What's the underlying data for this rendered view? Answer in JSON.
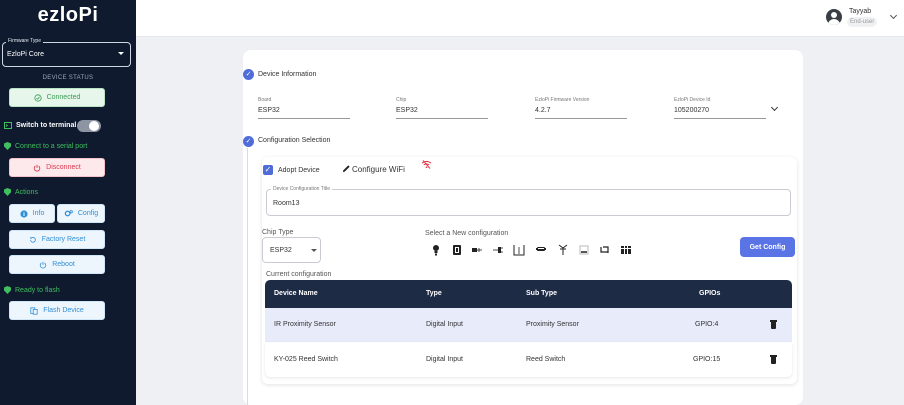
{
  "sidebar": {
    "logo": "ezloPi",
    "firmware_label": "Firmware Type",
    "firmware_value": "EzloPi Core",
    "device_status_label": "DEVICE STATUS",
    "connected_label": "Connected",
    "switch_terminal_label": "Switch to terminal",
    "connect_serial_label": "Connect to a serial port",
    "disconnect_label": "Disconnect",
    "actions_label": "Actions",
    "info_label": "Info",
    "config_label": "Config",
    "factory_reset_label": "Factory Reset",
    "reboot_label": "Reboot",
    "ready_flash_label": "Ready to flash",
    "flash_device_label": "Flash Device"
  },
  "header": {
    "user_name": "Tayyab",
    "user_role": "End-user"
  },
  "device_info": {
    "title": "Device Information",
    "fields": [
      {
        "label": "Board",
        "value": "ESP32"
      },
      {
        "label": "Chip",
        "value": "ESP32"
      },
      {
        "label": "EzloPi Firmware Version",
        "value": "4.2.7"
      },
      {
        "label": "EzloPi Device Id",
        "value": "105200270"
      }
    ]
  },
  "config_selection": {
    "title": "Configuration Selection",
    "adopt_device_label": "Adopt Device",
    "configure_wifi_label": "Configure WiFi",
    "device_config_title_label": "Device Configuration Title",
    "device_config_title_value": "Room13",
    "chip_type_label": "Chip Type",
    "chip_type_value": "ESP32",
    "select_new_config_label": "Select a New configuration",
    "get_config_label": "Get Config",
    "current_config_label": "Current configuration",
    "device_icons": [
      "bulb-icon",
      "dimmer-icon",
      "dht-icon",
      "temperature-icon",
      "pir-icon",
      "display-icon",
      "relay-icon",
      "potentiometer-icon",
      "i2c-icon",
      "uart-icon"
    ],
    "table": {
      "columns": [
        "Device Name",
        "Type",
        "Sub Type",
        "GPIOs"
      ],
      "rows": [
        {
          "name": "IR Proximity Sensor",
          "type": "Digital Input",
          "subtype": "Proximity Sensor",
          "gpio": "GPIO:4"
        },
        {
          "name": "KY-025 Reed Switch",
          "type": "Digital Input",
          "subtype": "Reed Switch",
          "gpio": "GPIO:15"
        }
      ]
    }
  },
  "colors": {
    "sidebar_bg": "#0f1a2e",
    "accent": "#5a74e6",
    "table_header": "#1e2b45",
    "success": "#3fbf5f",
    "danger": "#d83a4c"
  }
}
